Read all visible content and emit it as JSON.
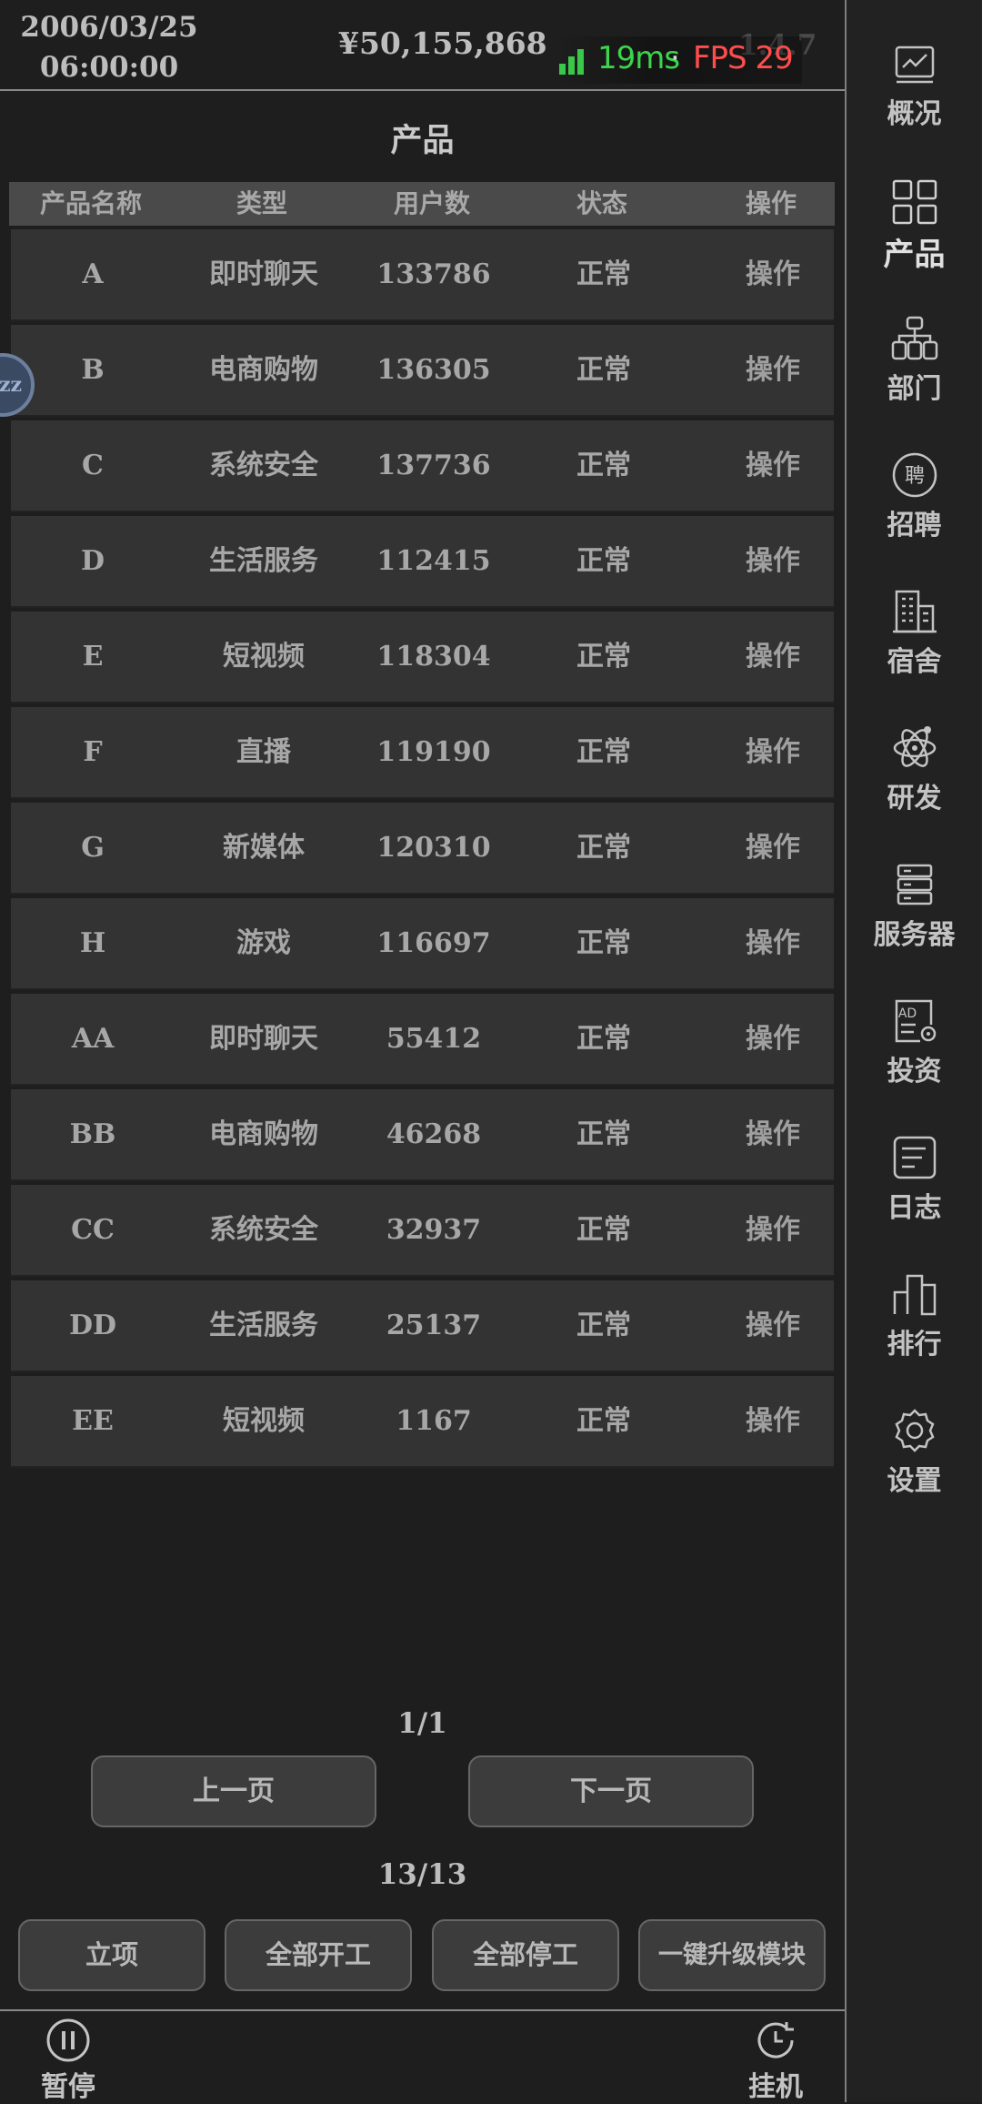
{
  "header": {
    "date": "2006/03/25",
    "time": "06:00:00",
    "money": "¥50,155,868",
    "latency": "19ms",
    "separator": "·",
    "fps": "FPS 29",
    "version": "1.4.7"
  },
  "page": {
    "title": "产品"
  },
  "table": {
    "columns": [
      "产品名称",
      "类型",
      "用户数",
      "状态",
      "操作"
    ],
    "rows": [
      {
        "name": "A",
        "type": "即时聊天",
        "users": "133786",
        "status": "正常",
        "action": "操作"
      },
      {
        "name": "B",
        "type": "电商购物",
        "users": "136305",
        "status": "正常",
        "action": "操作"
      },
      {
        "name": "C",
        "type": "系统安全",
        "users": "137736",
        "status": "正常",
        "action": "操作"
      },
      {
        "name": "D",
        "type": "生活服务",
        "users": "112415",
        "status": "正常",
        "action": "操作"
      },
      {
        "name": "E",
        "type": "短视频",
        "users": "118304",
        "status": "正常",
        "action": "操作"
      },
      {
        "name": "F",
        "type": "直播",
        "users": "119190",
        "status": "正常",
        "action": "操作"
      },
      {
        "name": "G",
        "type": "新媒体",
        "users": "120310",
        "status": "正常",
        "action": "操作"
      },
      {
        "name": "H",
        "type": "游戏",
        "users": "116697",
        "status": "正常",
        "action": "操作"
      },
      {
        "name": "AA",
        "type": "即时聊天",
        "users": "55412",
        "status": "正常",
        "action": "操作"
      },
      {
        "name": "BB",
        "type": "电商购物",
        "users": "46268",
        "status": "正常",
        "action": "操作"
      },
      {
        "name": "CC",
        "type": "系统安全",
        "users": "32937",
        "status": "正常",
        "action": "操作"
      },
      {
        "name": "DD",
        "type": "生活服务",
        "users": "25137",
        "status": "正常",
        "action": "操作"
      },
      {
        "name": "EE",
        "type": "短视频",
        "users": "1167",
        "status": "正常",
        "action": "操作"
      }
    ]
  },
  "floating": {
    "label": "zz"
  },
  "pagination": {
    "page": "1/1",
    "prev": "上一页",
    "next": "下一页",
    "count": "13/13"
  },
  "actions": {
    "new_project": "立项",
    "start_all": "全部开工",
    "stop_all": "全部停工",
    "upgrade_all": "一键升级模块"
  },
  "bottombar": {
    "pause": "暂停",
    "idle": "挂机"
  },
  "sidebar": {
    "items": [
      {
        "label": "概况",
        "icon": "chart-icon"
      },
      {
        "label": "产品",
        "icon": "grid-icon",
        "active": true
      },
      {
        "label": "部门",
        "icon": "org-chart-icon"
      },
      {
        "label": "招聘",
        "icon": "hire-icon",
        "icon_text": "聘"
      },
      {
        "label": "宿舍",
        "icon": "building-icon"
      },
      {
        "label": "研发",
        "icon": "atom-icon"
      },
      {
        "label": "服务器",
        "icon": "server-icon"
      },
      {
        "label": "投资",
        "icon": "ad-icon",
        "icon_text": "AD"
      },
      {
        "label": "日志",
        "icon": "log-icon"
      },
      {
        "label": "排行",
        "icon": "ranking-icon"
      },
      {
        "label": "设置",
        "icon": "gear-icon"
      }
    ]
  },
  "colors": {
    "background": "#1e1e1e",
    "row": "#333333",
    "latency_green": "#3bd44c",
    "fps_red": "#ff4d4d"
  }
}
